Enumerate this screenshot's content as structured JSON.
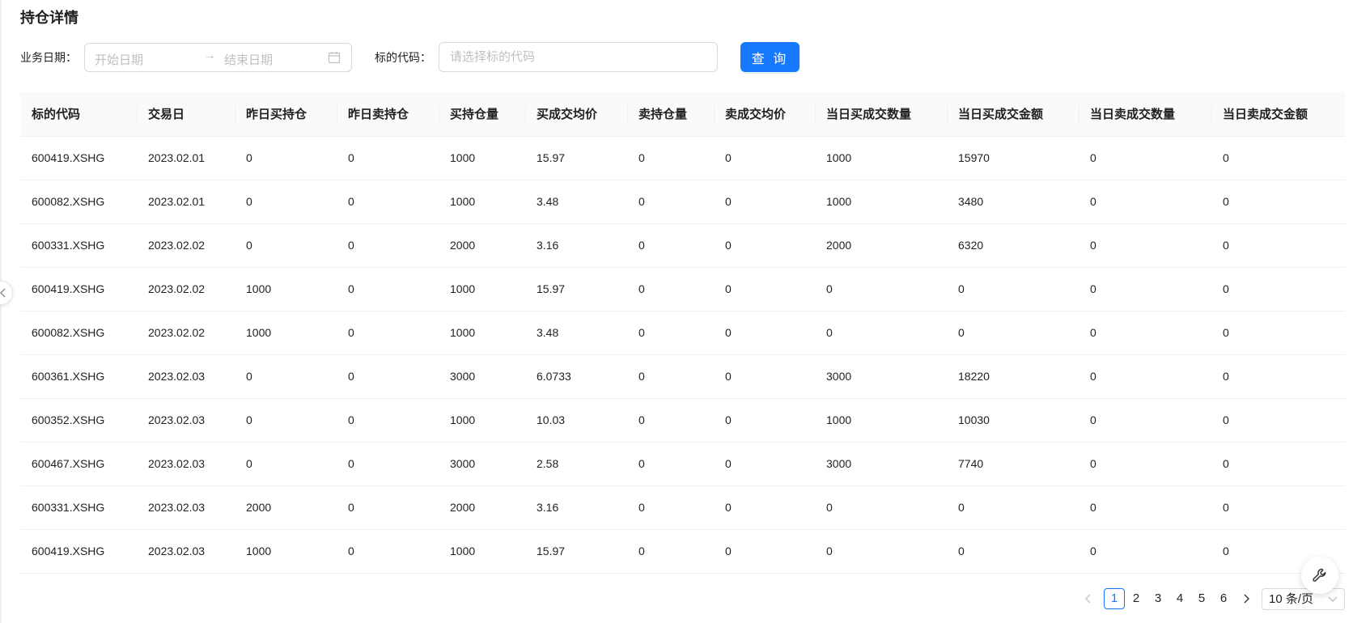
{
  "page": {
    "title": "持仓详情"
  },
  "filters": {
    "date_label": "业务日期：",
    "start_placeholder": "开始日期",
    "range_separator": "→",
    "end_placeholder": "结束日期",
    "code_label": "标的代码：",
    "code_placeholder": "请选择标的代码",
    "query_button": "查 询"
  },
  "table": {
    "columns": [
      "标的代码",
      "交易日",
      "昨日买持仓",
      "昨日卖持仓",
      "买持仓量",
      "买成交均价",
      "卖持仓量",
      "卖成交均价",
      "当日买成交数量",
      "当日买成交金额",
      "当日卖成交数量",
      "当日卖成交金额"
    ],
    "rows": [
      [
        "600419.XSHG",
        "2023.02.01",
        "0",
        "0",
        "1000",
        "15.97",
        "0",
        "0",
        "1000",
        "15970",
        "0",
        "0"
      ],
      [
        "600082.XSHG",
        "2023.02.01",
        "0",
        "0",
        "1000",
        "3.48",
        "0",
        "0",
        "1000",
        "3480",
        "0",
        "0"
      ],
      [
        "600331.XSHG",
        "2023.02.02",
        "0",
        "0",
        "2000",
        "3.16",
        "0",
        "0",
        "2000",
        "6320",
        "0",
        "0"
      ],
      [
        "600419.XSHG",
        "2023.02.02",
        "1000",
        "0",
        "1000",
        "15.97",
        "0",
        "0",
        "0",
        "0",
        "0",
        "0"
      ],
      [
        "600082.XSHG",
        "2023.02.02",
        "1000",
        "0",
        "1000",
        "3.48",
        "0",
        "0",
        "0",
        "0",
        "0",
        "0"
      ],
      [
        "600361.XSHG",
        "2023.02.03",
        "0",
        "0",
        "3000",
        "6.0733",
        "0",
        "0",
        "3000",
        "18220",
        "0",
        "0"
      ],
      [
        "600352.XSHG",
        "2023.02.03",
        "0",
        "0",
        "1000",
        "10.03",
        "0",
        "0",
        "1000",
        "10030",
        "0",
        "0"
      ],
      [
        "600467.XSHG",
        "2023.02.03",
        "0",
        "0",
        "3000",
        "2.58",
        "0",
        "0",
        "3000",
        "7740",
        "0",
        "0"
      ],
      [
        "600331.XSHG",
        "2023.02.03",
        "2000",
        "0",
        "2000",
        "3.16",
        "0",
        "0",
        "0",
        "0",
        "0",
        "0"
      ],
      [
        "600419.XSHG",
        "2023.02.03",
        "1000",
        "0",
        "1000",
        "15.97",
        "0",
        "0",
        "0",
        "0",
        "0",
        "0"
      ]
    ]
  },
  "pagination": {
    "pages": [
      "1",
      "2",
      "3",
      "4",
      "5",
      "6"
    ],
    "current": "1",
    "page_size": "10 条/页"
  },
  "icons": {
    "collapse": "chevron-left-icon",
    "calendar": "calendar-icon",
    "prev": "chevron-left-icon",
    "next": "chevron-right-icon",
    "dropdown": "chevron-down-icon",
    "float": "wrench-icon"
  },
  "colors": {
    "primary": "#1677ff",
    "header_bg": "#fafafa",
    "border": "#f0f0f0"
  }
}
